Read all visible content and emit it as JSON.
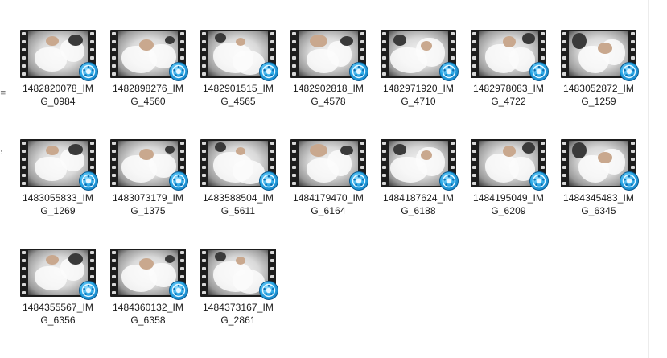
{
  "files": [
    {
      "name_line1": "1482820078_IM",
      "name_line2": "G_0984",
      "icon": "video-file-icon"
    },
    {
      "name_line1": "1482898276_IM",
      "name_line2": "G_4560",
      "icon": "video-file-icon"
    },
    {
      "name_line1": "1482901515_IM",
      "name_line2": "G_4565",
      "icon": "video-file-icon"
    },
    {
      "name_line1": "1482902818_IM",
      "name_line2": "G_4578",
      "icon": "video-file-icon"
    },
    {
      "name_line1": "1482971920_IM",
      "name_line2": "G_4710",
      "icon": "video-file-icon"
    },
    {
      "name_line1": "1482978083_IM",
      "name_line2": "G_4722",
      "icon": "video-file-icon"
    },
    {
      "name_line1": "1483052872_IM",
      "name_line2": "G_1259",
      "icon": "video-file-icon"
    },
    {
      "name_line1": "1483055833_IM",
      "name_line2": "G_1269",
      "icon": "video-file-icon"
    },
    {
      "name_line1": "1483073179_IM",
      "name_line2": "G_1375",
      "icon": "video-file-icon"
    },
    {
      "name_line1": "1483588504_IM",
      "name_line2": "G_5611",
      "icon": "video-file-icon"
    },
    {
      "name_line1": "1484179470_IM",
      "name_line2": "G_6164",
      "icon": "video-file-icon"
    },
    {
      "name_line1": "1484187624_IM",
      "name_line2": "G_6188",
      "icon": "video-file-icon"
    },
    {
      "name_line1": "1484195049_IM",
      "name_line2": "G_6209",
      "icon": "video-file-icon"
    },
    {
      "name_line1": "1484345483_IM",
      "name_line2": "G_6345",
      "icon": "video-file-icon"
    },
    {
      "name_line1": "1484355567_IM",
      "name_line2": "G_6356",
      "icon": "video-file-icon"
    },
    {
      "name_line1": "1484360132_IM",
      "name_line2": "G_6358",
      "icon": "video-file-icon"
    },
    {
      "name_line1": "1484373167_IM",
      "name_line2": "G_2861",
      "icon": "video-file-icon"
    }
  ],
  "overlay_icon": "media-player-play-icon",
  "colors": {
    "background": "#ffffff",
    "text": "#1a1a1a",
    "play_badge": "#2aa8e6",
    "film_strip": "#1d1d1d"
  }
}
